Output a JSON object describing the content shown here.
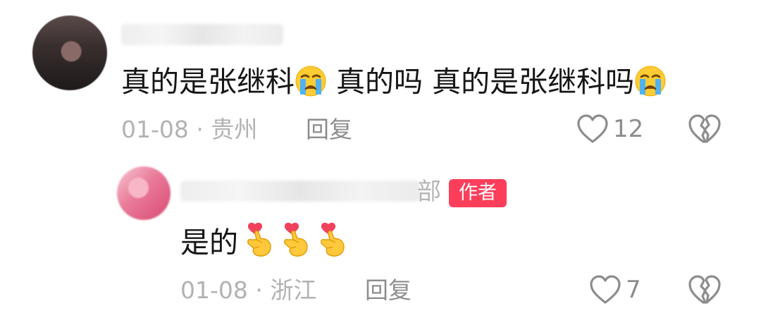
{
  "comment": {
    "text_part1": "真的是张继科",
    "text_part2": " 真的吗 真的是张继科吗",
    "date": "01-08",
    "separator": " · ",
    "location": "贵州",
    "reply_label": "回复",
    "likes": "12",
    "emoji_icon": "crying-face-icon"
  },
  "reply": {
    "name_suffix": "部",
    "author_badge": "作者",
    "text": "是的",
    "emoji_icon": "finger-heart-icon",
    "emoji_count": 3,
    "date": "01-08",
    "separator": " · ",
    "location": "浙江",
    "reply_label": "回复",
    "likes": "7"
  },
  "colors": {
    "badge": "#fb3f5b",
    "meta": "#b2b2b2",
    "icon": "#8d8d8d"
  }
}
